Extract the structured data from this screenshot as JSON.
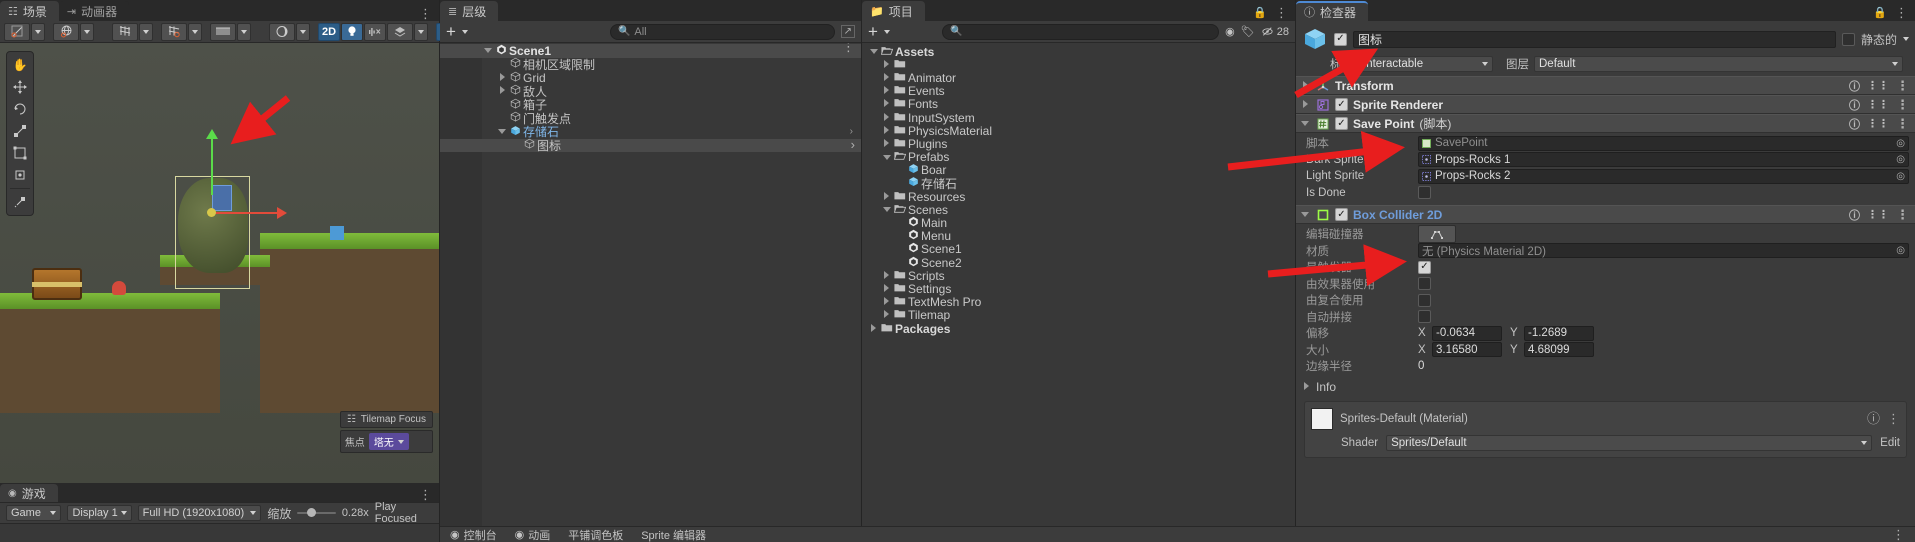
{
  "scene": {
    "tabs": [
      {
        "label": "场景",
        "icon": "grid-icon",
        "active": true
      },
      {
        "label": "动画器",
        "icon": "animator-icon",
        "active": false
      }
    ],
    "toolbar": {
      "pivot_label": "",
      "mode_2d": "2D",
      "buttons": [
        "pivot-rotation-icon",
        "global-local-icon",
        "grid-snap-icon",
        "grid-visibility-icon",
        "layers-icon",
        "shading-mode-icon",
        "2D",
        "lighting-icon",
        "audio-icon",
        "fx-icon",
        "visibility-toggle-icon",
        "camera-icon"
      ]
    },
    "tools": [
      "hand-tool",
      "move-tool",
      "rotate-tool",
      "scale-tool",
      "rect-tool",
      "transform-tool",
      "custom-tool"
    ],
    "overlay": {
      "tilemap_focus": "Tilemap Focus",
      "focus_label": "焦点",
      "focus_value": "塔无"
    }
  },
  "game": {
    "tabs": [
      {
        "label": "游戏",
        "icon": "game-icon",
        "active": true
      }
    ],
    "toolbar": {
      "mode": "Game",
      "display": "Display 1",
      "resolution": "Full HD (1920x1080)",
      "scale_label": "缩放",
      "scale_value": "0.28x",
      "play_focused": "Play Focused"
    }
  },
  "hierarchy": {
    "tab": "层级",
    "add_label": "+",
    "search_placeholder": "All",
    "items": [
      {
        "label": "Scene1",
        "indent": 0,
        "arrow": "down",
        "icon": "unity-scene-icon",
        "bold": true,
        "selected": false
      },
      {
        "label": "相机区域限制",
        "indent": 1,
        "arrow": "none",
        "icon": "gameobject-icon",
        "bold": false,
        "selected": false
      },
      {
        "label": "Grid",
        "indent": 1,
        "arrow": "right",
        "icon": "gameobject-icon",
        "bold": false,
        "selected": false
      },
      {
        "label": "敌人",
        "indent": 1,
        "arrow": "right",
        "icon": "gameobject-icon",
        "bold": false,
        "selected": false
      },
      {
        "label": "箱子",
        "indent": 1,
        "arrow": "none",
        "icon": "gameobject-icon",
        "bold": false,
        "selected": false
      },
      {
        "label": "门触发点",
        "indent": 1,
        "arrow": "none",
        "icon": "gameobject-icon",
        "bold": false,
        "selected": false
      },
      {
        "label": "存储石",
        "indent": 1,
        "arrow": "down",
        "icon": "prefab-icon",
        "bold": false,
        "selected": false,
        "prefab": true
      },
      {
        "label": "图标",
        "indent": 2,
        "arrow": "none",
        "icon": "gameobject-icon",
        "bold": false,
        "selected": true
      }
    ]
  },
  "project": {
    "tab": "项目",
    "add_label": "+",
    "search_placeholder": "",
    "badge_count": "28",
    "items": [
      {
        "label": "Assets",
        "indent": 0,
        "arrow": "down",
        "icon": "folder-open-icon",
        "bold": true
      },
      {
        "label": "",
        "indent": 1,
        "arrow": "right",
        "icon": "folder-icon",
        "bold": false
      },
      {
        "label": "Animator",
        "indent": 1,
        "arrow": "right",
        "icon": "folder-icon",
        "bold": false
      },
      {
        "label": "Events",
        "indent": 1,
        "arrow": "right",
        "icon": "folder-icon",
        "bold": false
      },
      {
        "label": "Fonts",
        "indent": 1,
        "arrow": "right",
        "icon": "folder-icon",
        "bold": false
      },
      {
        "label": "InputSystem",
        "indent": 1,
        "arrow": "right",
        "icon": "folder-icon",
        "bold": false
      },
      {
        "label": "PhysicsMaterial",
        "indent": 1,
        "arrow": "right",
        "icon": "folder-icon",
        "bold": false
      },
      {
        "label": "Plugins",
        "indent": 1,
        "arrow": "right",
        "icon": "folder-icon",
        "bold": false
      },
      {
        "label": "Prefabs",
        "indent": 1,
        "arrow": "down",
        "icon": "folder-open-icon",
        "bold": false
      },
      {
        "label": "Boar",
        "indent": 2,
        "arrow": "none",
        "icon": "prefab-icon",
        "bold": false
      },
      {
        "label": "存储石",
        "indent": 2,
        "arrow": "none",
        "icon": "prefab-icon",
        "bold": false
      },
      {
        "label": "Resources",
        "indent": 1,
        "arrow": "right",
        "icon": "folder-icon",
        "bold": false
      },
      {
        "label": "Scenes",
        "indent": 1,
        "arrow": "down",
        "icon": "folder-open-icon",
        "bold": false
      },
      {
        "label": "Main",
        "indent": 2,
        "arrow": "none",
        "icon": "unity-scene-icon",
        "bold": false
      },
      {
        "label": "Menu",
        "indent": 2,
        "arrow": "none",
        "icon": "unity-scene-icon",
        "bold": false
      },
      {
        "label": "Scene1",
        "indent": 2,
        "arrow": "none",
        "icon": "unity-scene-icon",
        "bold": false
      },
      {
        "label": "Scene2",
        "indent": 2,
        "arrow": "none",
        "icon": "unity-scene-icon",
        "bold": false
      },
      {
        "label": "Scripts",
        "indent": 1,
        "arrow": "right",
        "icon": "folder-icon",
        "bold": false
      },
      {
        "label": "Settings",
        "indent": 1,
        "arrow": "right",
        "icon": "folder-icon",
        "bold": false
      },
      {
        "label": "TextMesh Pro",
        "indent": 1,
        "arrow": "right",
        "icon": "folder-icon",
        "bold": false
      },
      {
        "label": "Tilemap",
        "indent": 1,
        "arrow": "right",
        "icon": "folder-icon",
        "bold": false
      },
      {
        "label": "Packages",
        "indent": 0,
        "arrow": "right",
        "icon": "folder-icon",
        "bold": true
      }
    ]
  },
  "inspector": {
    "tab": "检查器",
    "object_name": "图标",
    "enabled": true,
    "static_label": "静态的",
    "tag_label": "标签",
    "tag_value": "Interactable",
    "layer_label": "图层",
    "layer_value": "Default",
    "components": [
      {
        "name": "Transform",
        "icon": "transform-icon",
        "expanded": false,
        "has_checkbox": false,
        "checked": false,
        "suffix": "",
        "accent": "#e6e6e6",
        "props": []
      },
      {
        "name": "Sprite Renderer",
        "icon": "sprite-renderer-icon",
        "expanded": false,
        "has_checkbox": true,
        "checked": true,
        "suffix": "",
        "accent": "#e6e6e6",
        "props": []
      },
      {
        "name": "Save Point",
        "icon": "script-icon",
        "expanded": true,
        "has_checkbox": true,
        "checked": true,
        "suffix": "(脚本)",
        "accent": "#e6e6e6",
        "props": [
          {
            "label": "脚本",
            "type": "object",
            "value": "SavePoint",
            "dim": true,
            "icon": "script-asset-icon"
          },
          {
            "label": "Dark Sprite",
            "type": "object",
            "value": "Props-Rocks 1",
            "dim": false,
            "icon": "sprite-asset-icon"
          },
          {
            "label": "Light Sprite",
            "type": "object",
            "value": "Props-Rocks 2",
            "dim": false,
            "icon": "sprite-asset-icon"
          },
          {
            "label": "Is Done",
            "type": "checkbox",
            "value": false,
            "dim": false
          }
        ]
      },
      {
        "name": "Box Collider 2D",
        "icon": "box-collider-2d-icon",
        "expanded": true,
        "has_checkbox": true,
        "checked": true,
        "suffix": "",
        "accent": "#6f9ddb",
        "props": [
          {
            "label": "编辑碰撞器",
            "type": "button",
            "value": "edit-collider-icon",
            "dim": true
          },
          {
            "label": "材质",
            "type": "object",
            "value": "无 (Physics Material 2D)",
            "dim": true,
            "icon": ""
          },
          {
            "label": "是触发器",
            "type": "checkbox",
            "value": true,
            "dim": true
          },
          {
            "label": "由效果器使用",
            "type": "checkbox",
            "value": false,
            "dim": true
          },
          {
            "label": "由复合使用",
            "type": "checkbox",
            "value": false,
            "dim": true
          },
          {
            "label": "自动拼接",
            "type": "checkbox",
            "value": false,
            "dim": true
          },
          {
            "label": "偏移",
            "type": "vector2",
            "x_label": "X",
            "x": "-0.0634",
            "y_label": "Y",
            "y": "-1.2689",
            "dim": true
          },
          {
            "label": "大小",
            "type": "vector2",
            "x_label": "X",
            "x": "3.16580",
            "y_label": "Y",
            "y": "4.68099",
            "dim": true
          },
          {
            "label": "边缘半径",
            "type": "number",
            "value": "0",
            "dim": true
          }
        ]
      },
      {
        "name": "Info",
        "icon": "",
        "expanded": false,
        "has_checkbox": false,
        "checked": false,
        "suffix": "",
        "accent": "#c4c4c4",
        "props": []
      }
    ],
    "material_footer": {
      "title": "Sprites-Default (Material)",
      "shader_label": "Shader",
      "shader_value": "Sprites/Default",
      "edit_label": "Edit"
    }
  },
  "status_bar": {
    "items": [
      {
        "label": "控制台",
        "icon": "console-icon"
      },
      {
        "label": "动画",
        "icon": "animation-icon"
      },
      {
        "label": "平铺调色板",
        "icon": ""
      },
      {
        "label": "Sprite 编辑器",
        "icon": ""
      }
    ]
  },
  "colors": {
    "accent_blue": "#6f9ddb",
    "prefab_blue": "#67b3ef",
    "arrow_red": "#e81e1e",
    "panel_bg": "#383838",
    "toolbar_bg": "#3c3c3c",
    "header_bg": "#292929",
    "selection": "#4a4a4a",
    "collider_green": "#9dfb46"
  }
}
